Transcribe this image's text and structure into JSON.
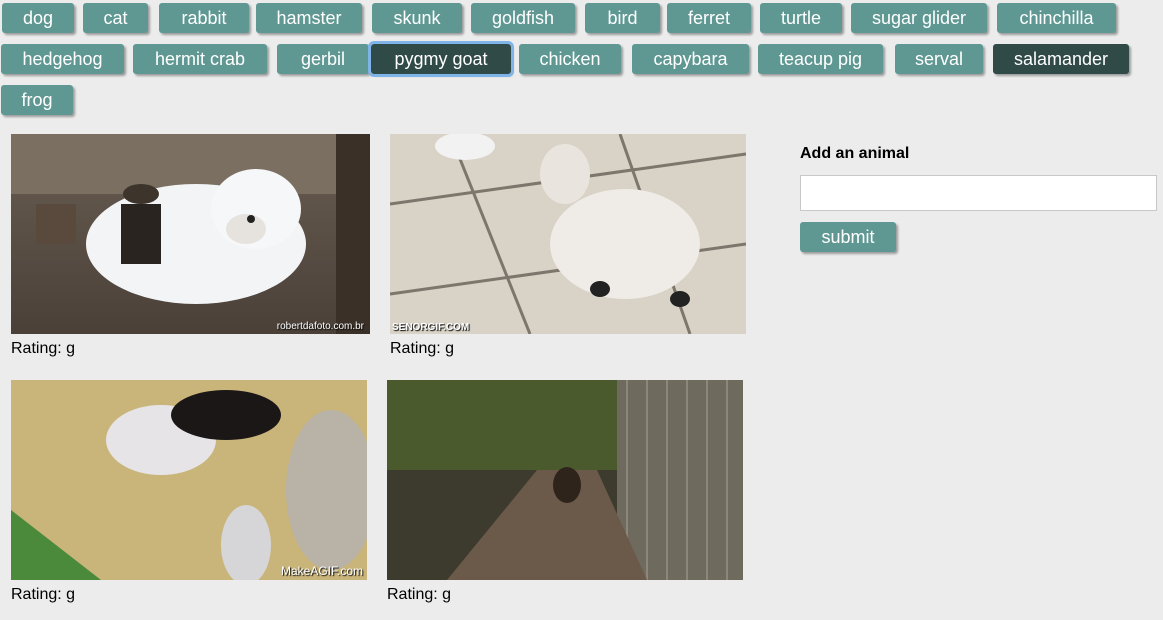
{
  "animals": [
    {
      "label": "dog"
    },
    {
      "label": "cat"
    },
    {
      "label": "rabbit"
    },
    {
      "label": "hamster"
    },
    {
      "label": "skunk"
    },
    {
      "label": "goldfish"
    },
    {
      "label": "bird"
    },
    {
      "label": "ferret"
    },
    {
      "label": "turtle"
    },
    {
      "label": "sugar glider"
    },
    {
      "label": "chinchilla"
    },
    {
      "label": "hedgehog"
    },
    {
      "label": "hermit crab"
    },
    {
      "label": "gerbil"
    },
    {
      "label": "pygmy goat",
      "state": "focused"
    },
    {
      "label": "chicken"
    },
    {
      "label": "capybara"
    },
    {
      "label": "teacup pig"
    },
    {
      "label": "serval"
    },
    {
      "label": "salamander",
      "state": "active"
    },
    {
      "label": "frog"
    }
  ],
  "results": [
    {
      "rating_label": "Rating:",
      "rating": "g",
      "watermark": "robertdafoto.com.br"
    },
    {
      "rating_label": "Rating:",
      "rating": "g",
      "watermark": "SENORGIF.COM"
    },
    {
      "rating_label": "Rating:",
      "rating": "g",
      "watermark": "MakeAGIF.com"
    },
    {
      "rating_label": "Rating:",
      "rating": "g",
      "watermark": ""
    }
  ],
  "form": {
    "title": "Add an animal",
    "input_value": "",
    "input_placeholder": "",
    "submit_label": "submit"
  },
  "colors": {
    "button": "#5f9893",
    "button_active": "#2f4a47",
    "focus_ring": "#7fb4e8",
    "background": "#ececec"
  }
}
